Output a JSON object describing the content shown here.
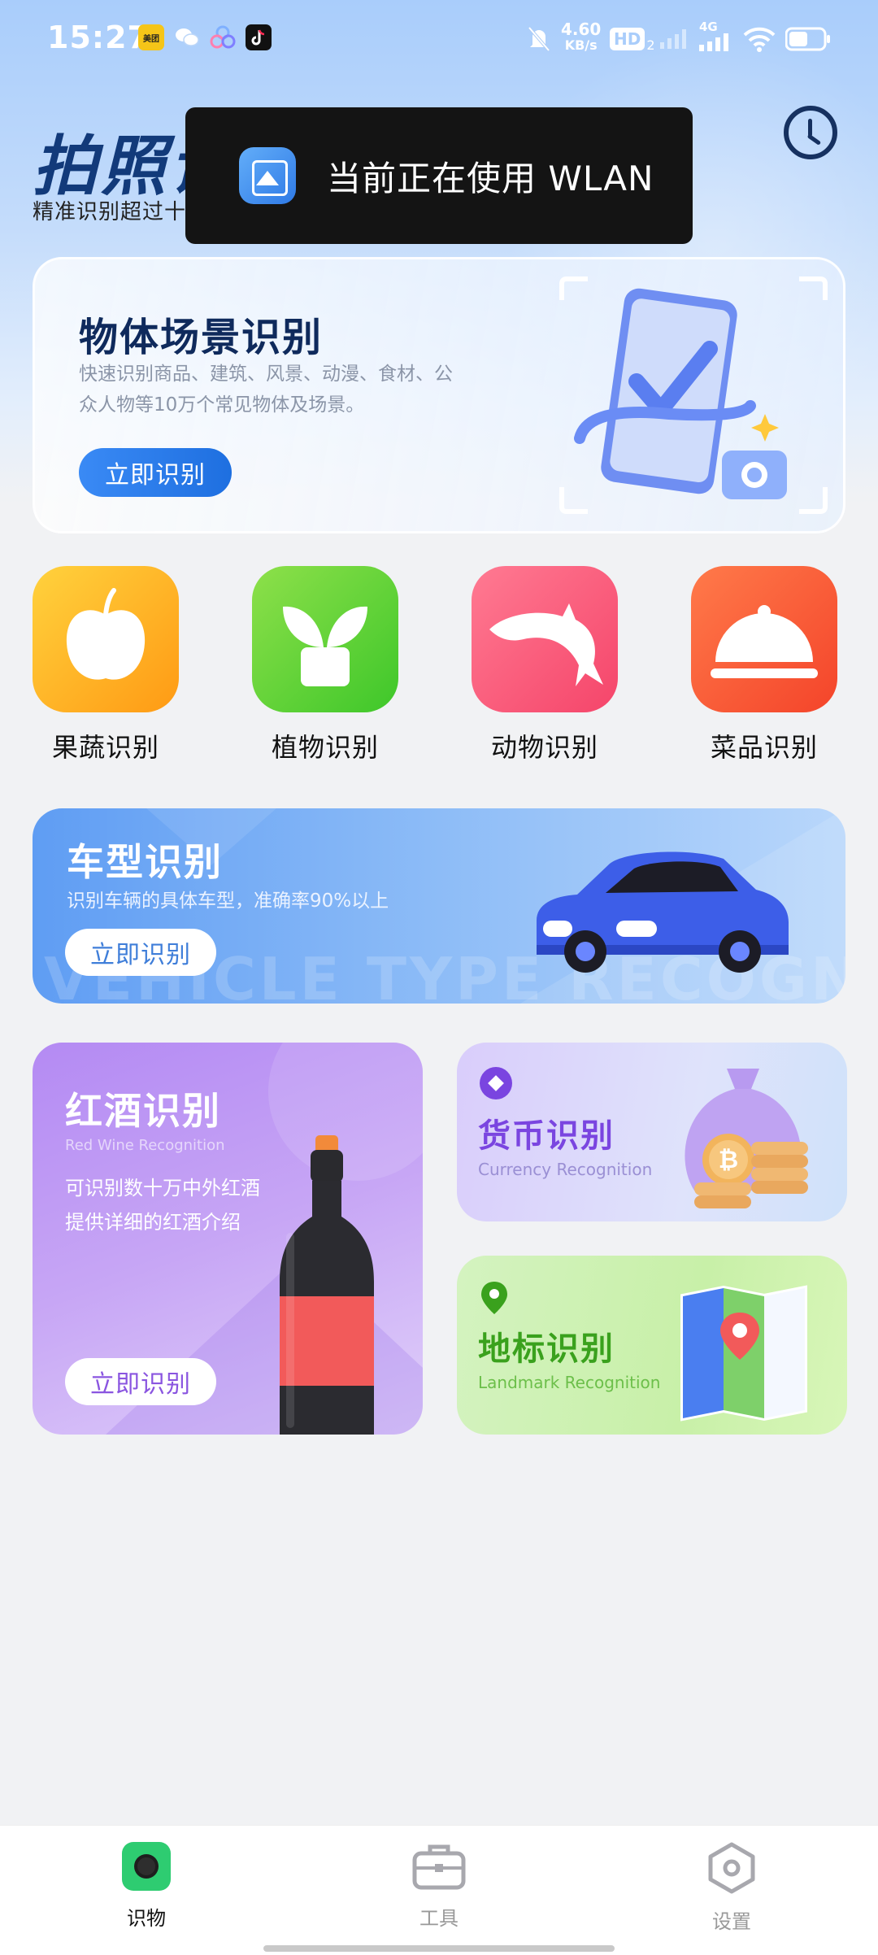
{
  "status_bar": {
    "time": "15:27",
    "net_speed_value": "4.60",
    "net_speed_unit": "KB/s",
    "hd_label": "HD",
    "hd_sub": "2",
    "network_label": "4G",
    "app_icons": [
      {
        "name": "meituan-app-icon",
        "label": "美团",
        "color": "#f5c518"
      },
      {
        "name": "wechat-app-icon",
        "label": "",
        "color": "#ffffff"
      },
      {
        "name": "triad-app-icon",
        "label": "",
        "color": "#ffffff"
      },
      {
        "name": "tiktok-app-icon",
        "label": "",
        "color": "#111111"
      }
    ]
  },
  "header": {
    "title": "拍照识",
    "subtitle": "精准识别超过十"
  },
  "toast": {
    "text": "当前正在使用 WLAN"
  },
  "scene_card": {
    "title": "物体场景识别",
    "description": "快速识别商品、建筑、风景、动漫、食材、公众人物等10万个常见物体及场景。",
    "button": "立即识别"
  },
  "categories": [
    {
      "label": "果蔬识别",
      "icon": "apple-icon",
      "color_from": "#ffd23d",
      "color_to": "#ff9a14"
    },
    {
      "label": "植物识别",
      "icon": "plant-icon",
      "color_from": "#8ee04a",
      "color_to": "#3ec72a"
    },
    {
      "label": "动物识别",
      "icon": "dolphin-icon",
      "color_from": "#ff7a92",
      "color_to": "#f5456a"
    },
    {
      "label": "菜品识别",
      "icon": "food-cloche-icon",
      "color_from": "#ff7a4a",
      "color_to": "#f4442a"
    }
  ],
  "vehicle_card": {
    "title": "车型识别",
    "description": "识别车辆的具体车型，准确率90%以上",
    "button": "立即识别",
    "watermark": "VEHICLE TYPE RECOGNITION"
  },
  "wine_card": {
    "title": "红酒识别",
    "subtitle_en": "Red Wine Recognition",
    "description": "可识别数十万中外红酒提供详细的红酒介绍",
    "button": "立即识别"
  },
  "currency_card": {
    "title": "货币识别",
    "subtitle_en": "Currency Recognition",
    "coin_symbol": "₿"
  },
  "landmark_card": {
    "title": "地标识别",
    "subtitle_en": "Landmark Recognition"
  },
  "bottom_nav": [
    {
      "label": "识物",
      "icon": "camera-icon",
      "active": true
    },
    {
      "label": "工具",
      "icon": "toolbox-icon",
      "active": false
    },
    {
      "label": "设置",
      "icon": "settings-hexagon-icon",
      "active": false
    }
  ],
  "colors": {
    "accent_blue": "#1e6fe0",
    "title_navy": "#0f2a5c",
    "nav_active_green": "#2ecc71",
    "wine_purple": "#b48af3",
    "currency_title": "#7a45e0",
    "landmark_title": "#3aa11d"
  }
}
